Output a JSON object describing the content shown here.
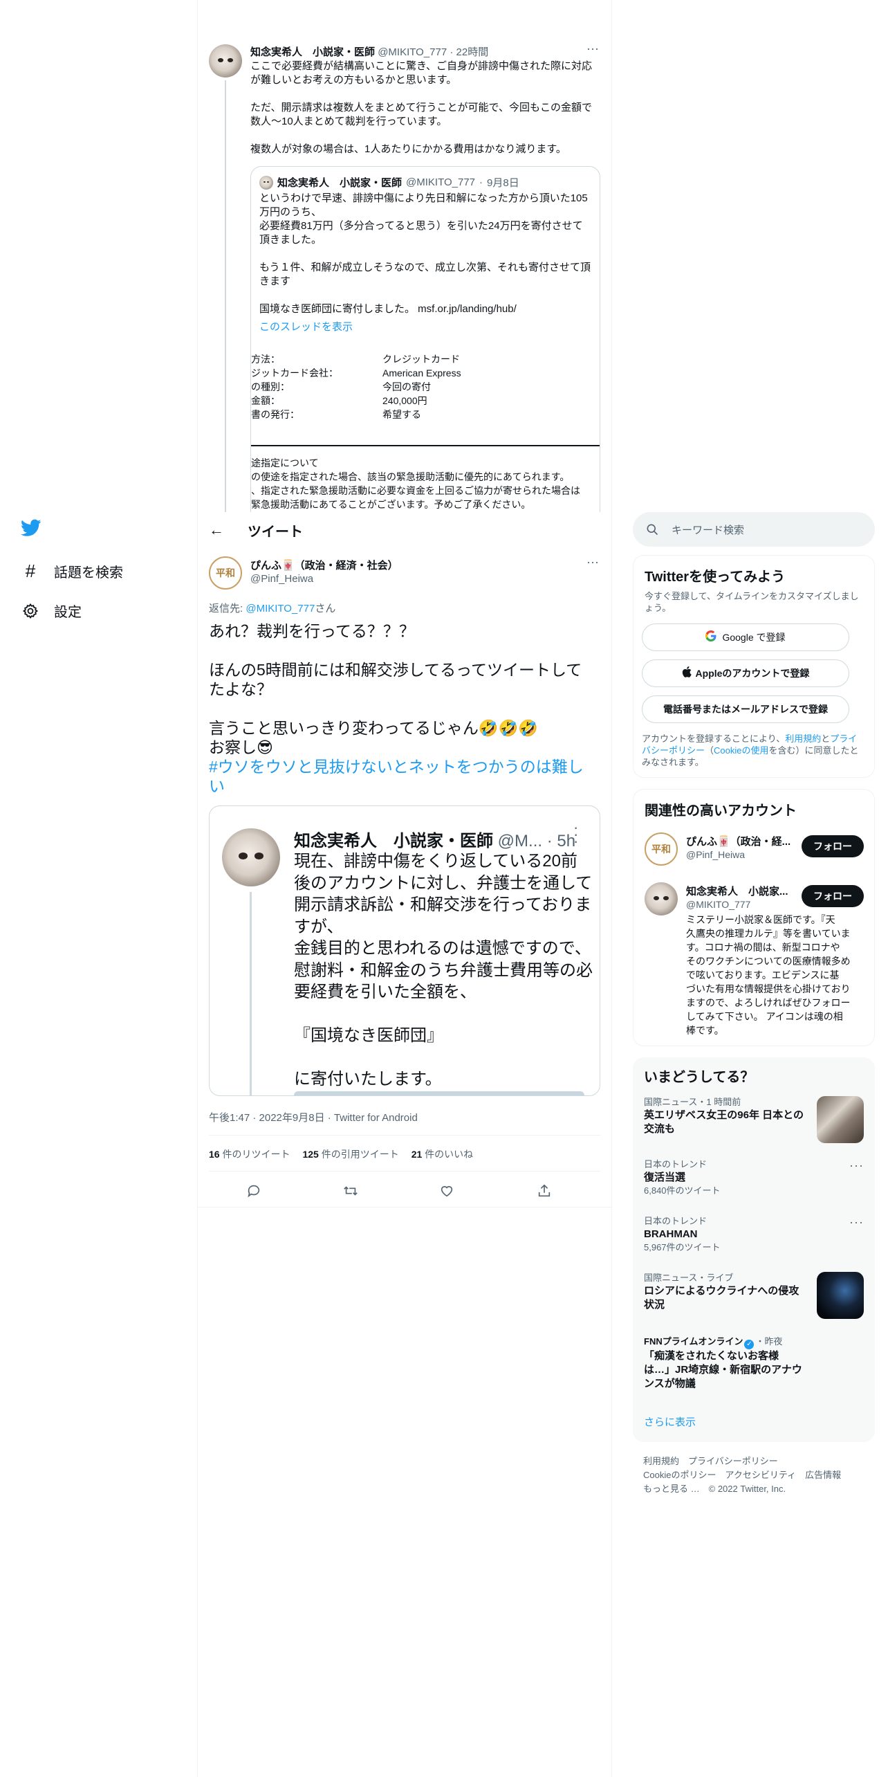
{
  "sidebar": {
    "logo": "twitter-bird",
    "items": [
      {
        "icon": "hashtag",
        "label": "話題を検索"
      },
      {
        "icon": "gear",
        "label": "設定"
      }
    ]
  },
  "bg_tweet": {
    "author": "知念実希人　小説家・医師",
    "handle": "@MIKITO_777",
    "time": "22時間",
    "lines": [
      "ここで必要経費が結構高いことに驚き、ご自身が誹謗中傷された際に対応",
      "が難しいとお考えの方もいるかと思います。",
      "",
      "ただ、開示請求は複数人をまとめて行うことが可能で、今回もこの金額で",
      "数人〜10人まとめて裁判を行っています。",
      "",
      "複数人が対象の場合は、1人あたりにかかる費用はかなり減ります。"
    ],
    "quote": {
      "author": "知念実希人　小説家・医師",
      "handle": "@MIKITO_777",
      "date": "9月8日",
      "lines": [
        "というわけで早速、誹謗中傷により先日和解になった方から頂いた105",
        "万円のうち、",
        "必要経費81万円（多分合ってると思う）を引いた24万円を寄付させて",
        "頂きました。",
        "",
        "もう１件、和解が成立しそうなので、成立し次第、それも寄付させて頂",
        "きます",
        "",
        "国境なき医師団に寄付しました。 msf.or.jp/landing/hub/"
      ],
      "show_thread": "このスレッドを表示",
      "receipt_rows": [
        {
          "k": "方法：",
          "v": "クレジットカード"
        },
        {
          "k": "ジットカード会社：",
          "v": "American Express"
        },
        {
          "k": "の種別：",
          "v": "今回の寄付"
        },
        {
          "k": "金額：",
          "v": "240,000円"
        },
        {
          "k": "書の発行：",
          "v": "希望する"
        }
      ],
      "notice_lines": [
        "途指定について",
        "の使途を指定された場合、該当の緊急援助活動に優先的にあてられます。",
        "、指定された緊急援助活動に必要な資金を上回るご協力が寄せられた場合は",
        "緊急援助活動にあてることがございます。予めご了承ください。"
      ]
    }
  },
  "header": {
    "back": "←",
    "title": "ツイート"
  },
  "main_tweet": {
    "author": "ぴんふ🀄（政治・経済・社会）",
    "handle": "@Pinf_Heiwa",
    "avatar_text": "平和",
    "reply_prefix": "返信先: ",
    "reply_to": "@MIKITO_777",
    "reply_suffix": "さん",
    "lines": [
      "あれ？裁判を行ってる？？？",
      "",
      "ほんの5時間前には和解交渉してるってツイートして",
      "たよな？",
      "",
      "言うこと思いっきり変わってるじゃん🤣🤣🤣",
      "お察し😎"
    ],
    "hashtag_lines": [
      "#ウソをウソと見抜けないとネットをつかうのは難し",
      "い"
    ],
    "embed": {
      "author": "知念実希人　小説家・医師",
      "handle_time": "@M... · 5h",
      "lines": [
        "現在、誹謗中傷をくり返している20前",
        "後のアカウントに対し、弁護士を通して",
        "開示請求訴訟・和解交渉を行っておりま",
        "すが、",
        "金銭目的と思われるのは遺憾ですので、",
        "慰謝料・和解金のうち弁護士費用等の必",
        "要経費を引いた全額を、",
        "",
        "『国境なき医師団』",
        "",
        "に寄付いたします。"
      ]
    },
    "meta": "午後1:47 · 2022年9月8日 · Twitter for Android",
    "stats": [
      {
        "num": "16",
        "label": " 件のリツイート"
      },
      {
        "num": "125",
        "label": " 件の引用ツイート"
      },
      {
        "num": "21",
        "label": " 件のいいね"
      }
    ]
  },
  "search": {
    "placeholder": "キーワード検索"
  },
  "signup": {
    "title": "Twitterを使ってみよう",
    "subtitle_lines": [
      "今すぐ登録して、タイムラインをカスタマイズしまし",
      "ょう。"
    ],
    "google": "Google で登録",
    "apple": "Appleのアカウントで登録",
    "phone": "電話番号またはメールアドレスで登録",
    "terms_lines": [
      {
        "parts": [
          "アカウントを登録することにより、",
          "利用規約",
          "と",
          "プライ"
        ]
      },
      {
        "parts": [
          "バシーポリシー",
          "（",
          "Cookieの使用",
          "を含む）に同意したと"
        ]
      },
      {
        "parts": [
          "みなされます。"
        ]
      }
    ]
  },
  "related": {
    "title": "関連性の高いアカウント",
    "accounts": [
      {
        "name": "ぴんふ🀄（政治・経...",
        "handle": "@Pinf_Heiwa",
        "button": "フォロー",
        "bio_lines": []
      },
      {
        "name": "知念実希人　小説家...",
        "handle": "@MIKITO_777",
        "button": "フォロー",
        "bio_lines": [
          "ミステリー小説家＆医師です。『天",
          "久鷹央の推理カルテ』等を書いていま",
          "す。コロナ禍の間は、新型コロナや",
          "そのワクチンについての医療情報多め",
          "で呟いております。エビデンスに基",
          "づいた有用な情報提供を心掛けており",
          "ますので、よろしければぜひフォロー",
          "してみて下さい。 アイコンは魂の相",
          "棒です。"
        ]
      }
    ]
  },
  "trends": {
    "title": "いまどうしてる？",
    "items": [
      {
        "meta": "国際ニュース・1 時間前",
        "title_lines": [
          "英エリザベス女王の96年 日本との",
          "交流も"
        ],
        "count": "",
        "thumb": "queen"
      },
      {
        "meta": "日本のトレンド",
        "title_lines": [
          "復活当選"
        ],
        "count": "6,840件のツイート",
        "thumb": ""
      },
      {
        "meta": "日本のトレンド",
        "title_lines": [
          "BRAHMAN"
        ],
        "count": "5,967件のツイート",
        "thumb": ""
      },
      {
        "meta": "国際ニュース・ライブ",
        "title_lines": [
          "ロシアによるウクライナへの侵攻",
          "状況"
        ],
        "count": "",
        "thumb": "night"
      },
      {
        "meta_source": "FNNプライムオンライン",
        "meta_time": "・昨夜",
        "title_lines": [
          "「痴漢をされたくないお客様",
          "は…」JR埼京線・新宿駅のアナウ",
          "ンスが物議"
        ],
        "count": "",
        "thumb": ""
      }
    ],
    "more": "さらに表示"
  },
  "footer": {
    "line1": [
      "利用規約",
      "プライバシーポリシー"
    ],
    "line2": [
      "Cookieのポリシー",
      "アクセシビリティ",
      "広告情報"
    ],
    "line3": [
      "もっと見る …",
      "© 2022 Twitter, Inc."
    ]
  },
  "colors": {
    "accent": "#1d9bf0",
    "text": "#0f1419",
    "muted": "#536471",
    "border": "#eff3f4"
  }
}
